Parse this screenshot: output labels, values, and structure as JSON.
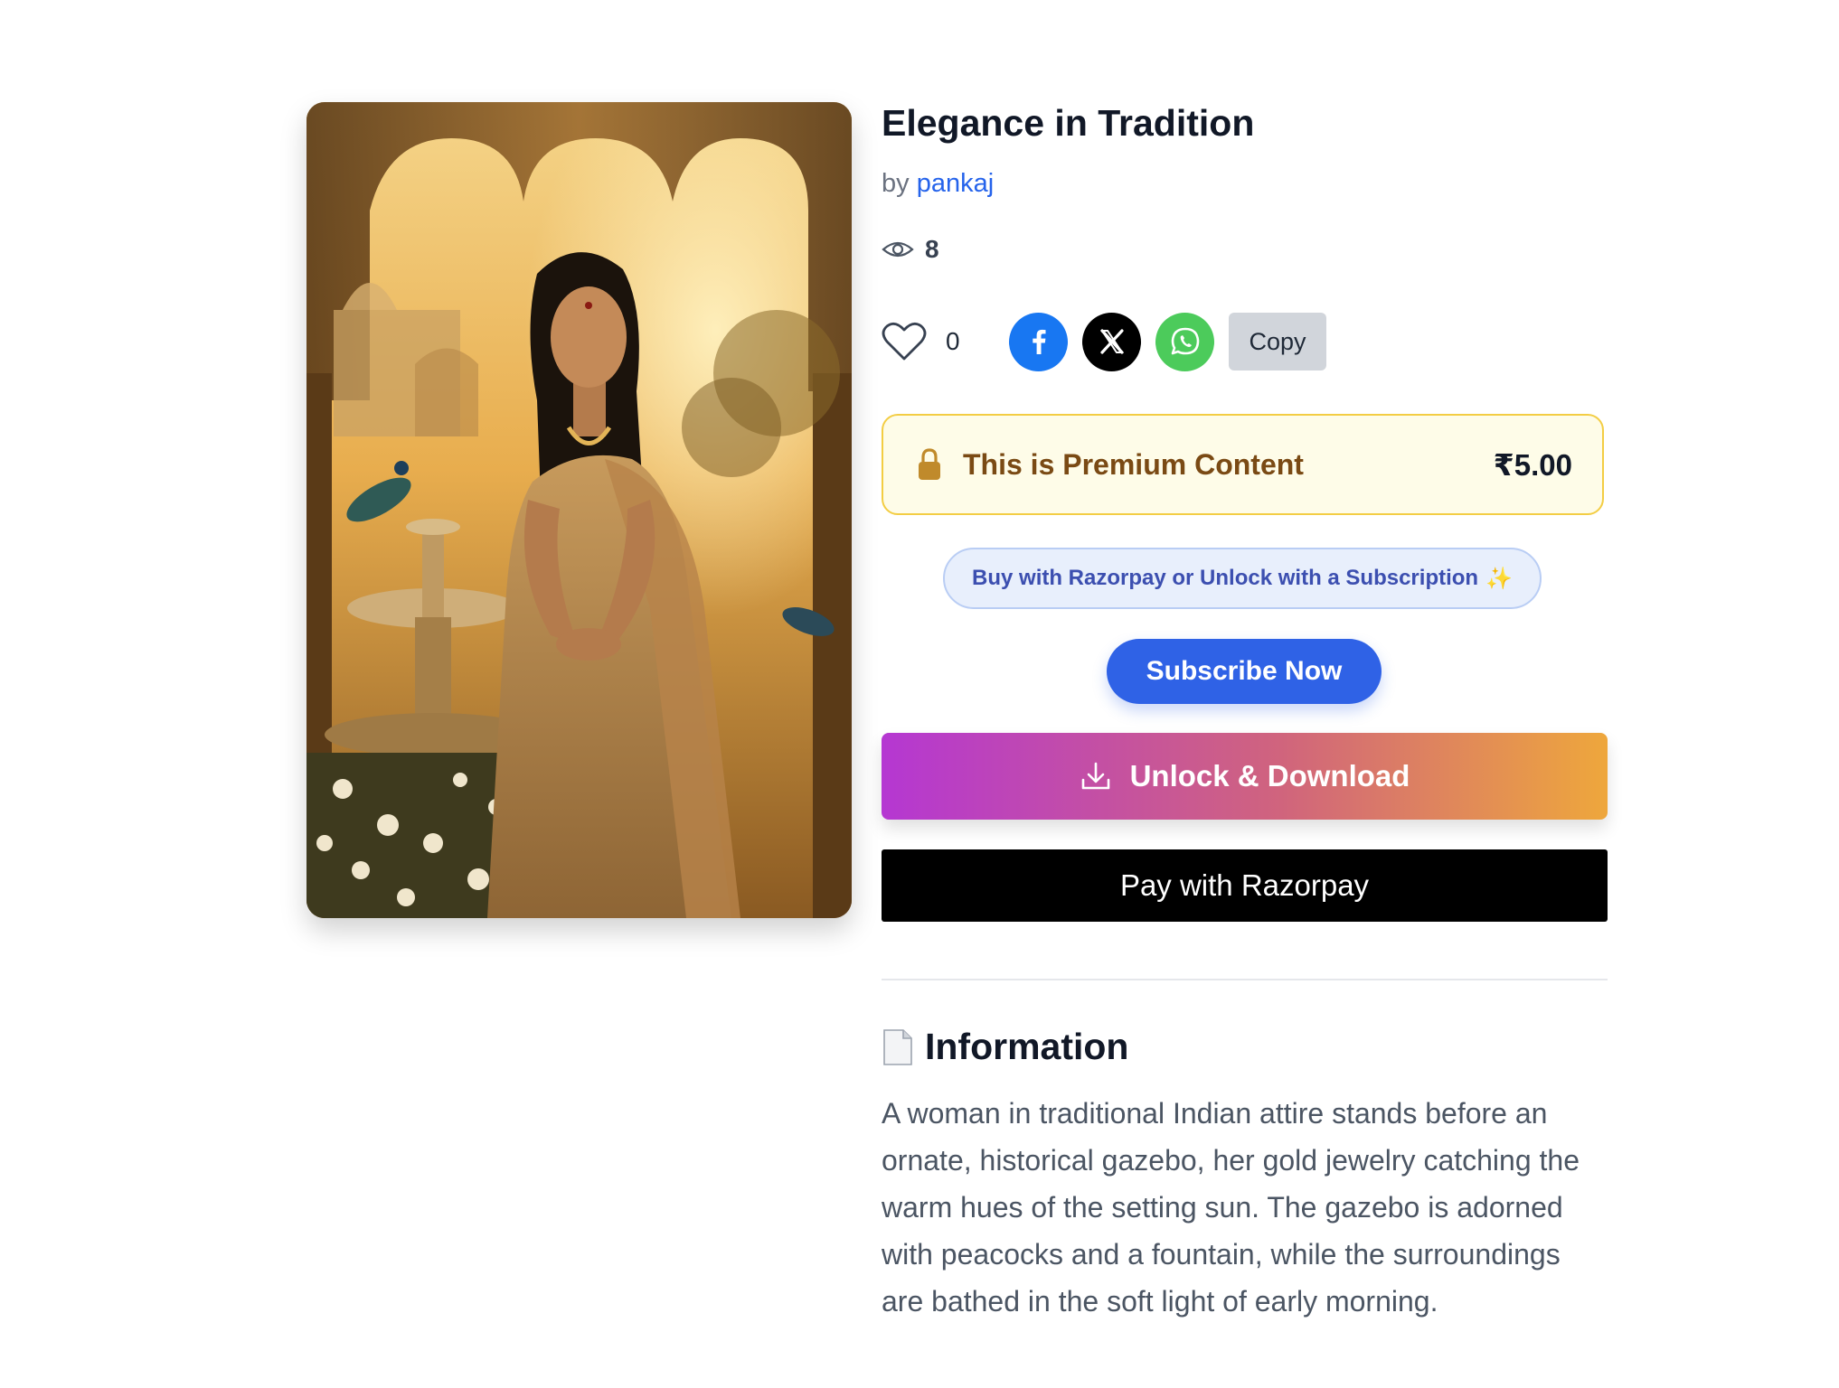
{
  "artwork": {
    "title": "Elegance in Tradition",
    "by_label": "by",
    "author": "pankaj",
    "views": "8",
    "likes": "0"
  },
  "share": {
    "copy_label": "Copy"
  },
  "premium": {
    "label": "This is Premium Content",
    "price": "₹5.00"
  },
  "actions": {
    "pill_label": "Buy with Razorpay or Unlock with a Subscription",
    "pill_sparkle": "✨",
    "subscribe_label": "Subscribe Now",
    "unlock_label": "Unlock & Download",
    "razorpay_label": "Pay with Razorpay"
  },
  "information": {
    "heading": "Information",
    "description": "A woman in traditional Indian attire stands before an ornate, historical gazebo, her gold jewelry catching the warm hues of the setting sun. The gazebo is adorned with peacocks and a fountain, while the surroundings are bathed in the soft light of early morning."
  },
  "icons": {
    "views": "eye-icon",
    "like": "heart-icon",
    "facebook": "facebook-icon",
    "x": "x-icon",
    "whatsapp": "whatsapp-icon",
    "lock": "lock-icon",
    "download": "download-icon",
    "info": "document-icon"
  },
  "colors": {
    "link": "#2563eb",
    "facebook": "#1877f2",
    "whatsapp": "#4ccb5b",
    "subscribe": "#2f62e6",
    "premium_border": "#f3cd44",
    "premium_text": "#7a4a14",
    "gradient_start": "#b537d2",
    "gradient_end": "#eea73c"
  }
}
